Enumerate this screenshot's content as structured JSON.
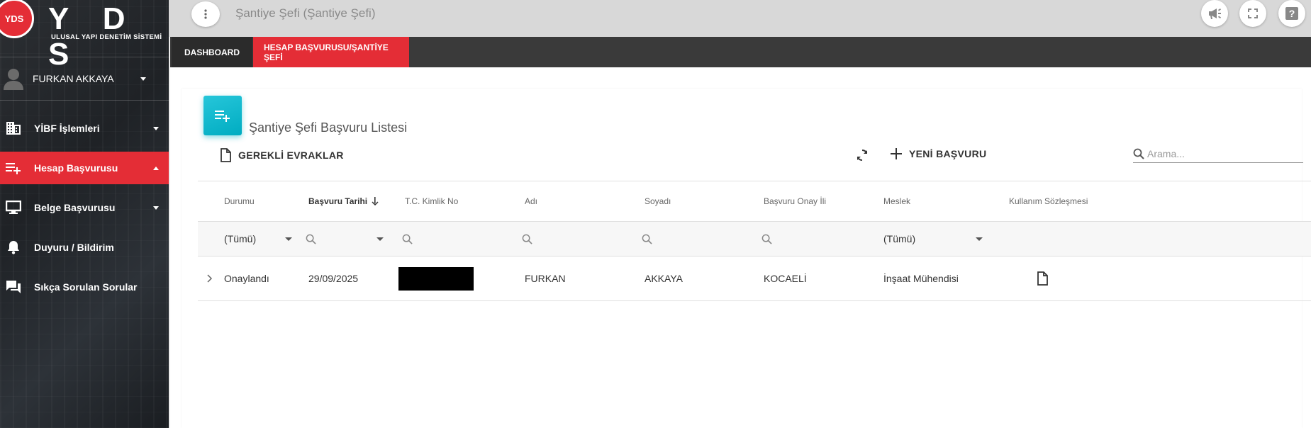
{
  "brand": {
    "logo_mark": "YDS",
    "name": "Y D S",
    "subtitle": "ULUSAL YAPI DENETİM SİSTEMİ",
    "accent_color": "#e42d36"
  },
  "user": {
    "name": "FURKAN AKKAYA"
  },
  "sidebar": {
    "items": [
      {
        "label": "YİBF İşlemleri",
        "icon": "building-icon"
      },
      {
        "label": "Hesap Başvurusu",
        "icon": "playlist-add-icon",
        "active": true
      },
      {
        "label": "Belge Başvurusu",
        "icon": "monitor-icon"
      },
      {
        "label": "Duyuru / Bildirim",
        "icon": "bell-icon"
      },
      {
        "label": "Sıkça Sorulan Sorular",
        "icon": "forum-icon"
      }
    ]
  },
  "topbar": {
    "title": "Şantiye Şefi (Şantiye Şefi)",
    "icons": [
      "announcement-icon",
      "fullscreen-icon",
      "help-icon"
    ]
  },
  "breadcrumb": {
    "items": [
      "DASHBOARD",
      "HESAP BAŞVURUSU/ŞANTİYE ŞEFİ"
    ]
  },
  "card": {
    "title": "Şantiye Şefi Başvuru Listesi",
    "required_docs_label": "GEREKLİ EVRAKLAR",
    "new_application_label": "YENİ BAŞVURU",
    "search_placeholder": "Arama..."
  },
  "grid": {
    "columns": [
      "Durumu",
      "Başvuru Tarihi",
      "T.C. Kimlik No",
      "Adı",
      "Soyadı",
      "Başvuru Onay İli",
      "Meslek",
      "Kullanım Sözleşmesi"
    ],
    "sorted_column": "Başvuru Tarihi",
    "filters": {
      "status": "(Tümü)",
      "profession": "(Tümü)"
    },
    "rows": [
      {
        "status": "Onaylandı",
        "date": "29/09/2025",
        "tc_no": "",
        "first_name": "FURKAN",
        "last_name": "AKKAYA",
        "province": "KOCAELİ",
        "profession": "İnşaat Mühendisi"
      }
    ]
  }
}
